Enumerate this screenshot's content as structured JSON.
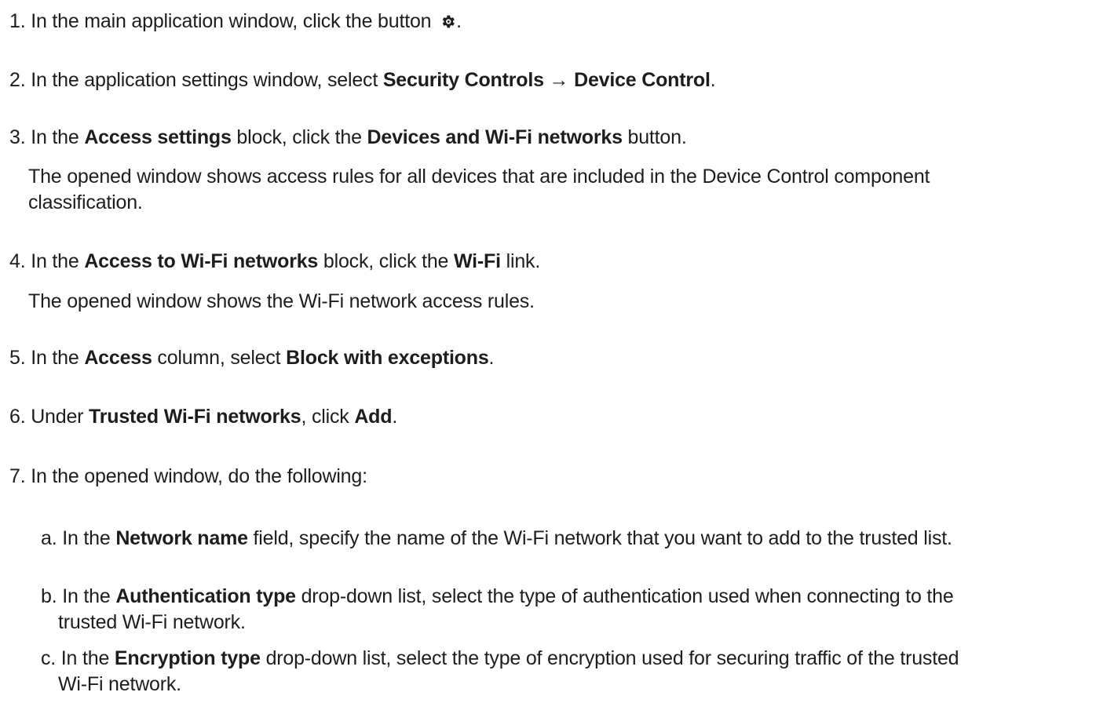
{
  "steps": [
    {
      "num": "1.",
      "t1": "In the main application window, click the button",
      "icon": "gear-icon",
      "t2": "."
    },
    {
      "num": "2.",
      "t1": "In the application settings window, select ",
      "b1": "Security Controls → Device Control",
      "t2": "."
    },
    {
      "num": "3.",
      "t1": "In the ",
      "b1": "Access settings",
      "t2": " block, click the ",
      "b2": "Devices and Wi-Fi networks",
      "t3": " button.",
      "note_line1": "The opened window shows access rules for all devices that are included in the Device Control component",
      "note_line2": "classification."
    },
    {
      "num": "4.",
      "t1": "In the ",
      "b1": "Access to Wi-Fi networks",
      "t2": " block, click the ",
      "b2": "Wi-Fi",
      "t3": " link.",
      "note_line1": "The opened window shows the Wi-Fi network access rules."
    },
    {
      "num": "5.",
      "t1": "In the ",
      "b1": "Access",
      "t2": " column, select ",
      "b2": "Block with exceptions",
      "t3": "."
    },
    {
      "num": "6.",
      "t1": "Under ",
      "b1": "Trusted Wi-Fi networks",
      "t2": ", click ",
      "b2": "Add",
      "t3": "."
    },
    {
      "num": "7.",
      "t1": "In the opened window, do the following:"
    }
  ],
  "substeps": [
    {
      "letter": "a.",
      "t1": "In the ",
      "b1": "Network name",
      "t2": " field, specify the name of the Wi-Fi network that you want to add to the trusted list."
    },
    {
      "letter": "b.",
      "t1": "In the ",
      "b1": "Authentication type",
      "t2": " drop-down list, select the type of authentication used when connecting to the",
      "cont": "trusted Wi-Fi network."
    },
    {
      "letter": "c.",
      "t1": "In the ",
      "b1": "Encryption type",
      "t2": " drop-down list, select the type of encryption used for securing traffic of the trusted",
      "cont": "Wi-Fi network."
    }
  ]
}
